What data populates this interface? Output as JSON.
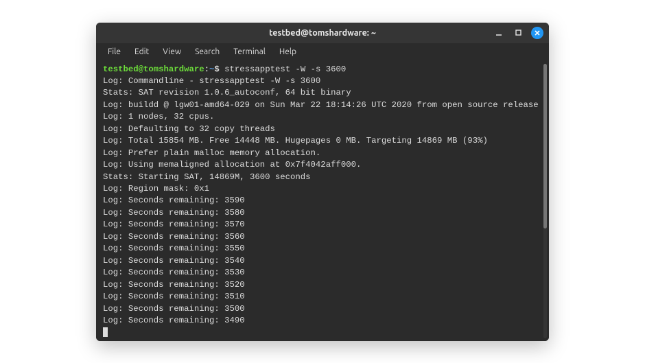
{
  "titlebar": {
    "title": "testbed@tomshardware: ~"
  },
  "menu": {
    "items": [
      "File",
      "Edit",
      "View",
      "Search",
      "Terminal",
      "Help"
    ]
  },
  "prompt": {
    "user_host": "testbed@tomshardware",
    "sep": ":",
    "path": "~",
    "sigil": "$"
  },
  "command": "stressapptest -W -s 3600",
  "output_lines": [
    "Log: Commandline - stressapptest -W -s 3600",
    "Stats: SAT revision 1.0.6_autoconf, 64 bit binary",
    "Log: buildd @ lgw01-amd64-029 on Sun Mar 22 18:14:26 UTC 2020 from open source release",
    "Log: 1 nodes, 32 cpus.",
    "Log: Defaulting to 32 copy threads",
    "Log: Total 15854 MB. Free 14448 MB. Hugepages 0 MB. Targeting 14869 MB (93%)",
    "Log: Prefer plain malloc memory allocation.",
    "Log: Using memaligned allocation at 0x7f4042aff000.",
    "Stats: Starting SAT, 14869M, 3600 seconds",
    "Log: Region mask: 0x1",
    "Log: Seconds remaining: 3590",
    "Log: Seconds remaining: 3580",
    "Log: Seconds remaining: 3570",
    "Log: Seconds remaining: 3560",
    "Log: Seconds remaining: 3550",
    "Log: Seconds remaining: 3540",
    "Log: Seconds remaining: 3530",
    "Log: Seconds remaining: 3520",
    "Log: Seconds remaining: 3510",
    "Log: Seconds remaining: 3500",
    "Log: Seconds remaining: 3490"
  ]
}
